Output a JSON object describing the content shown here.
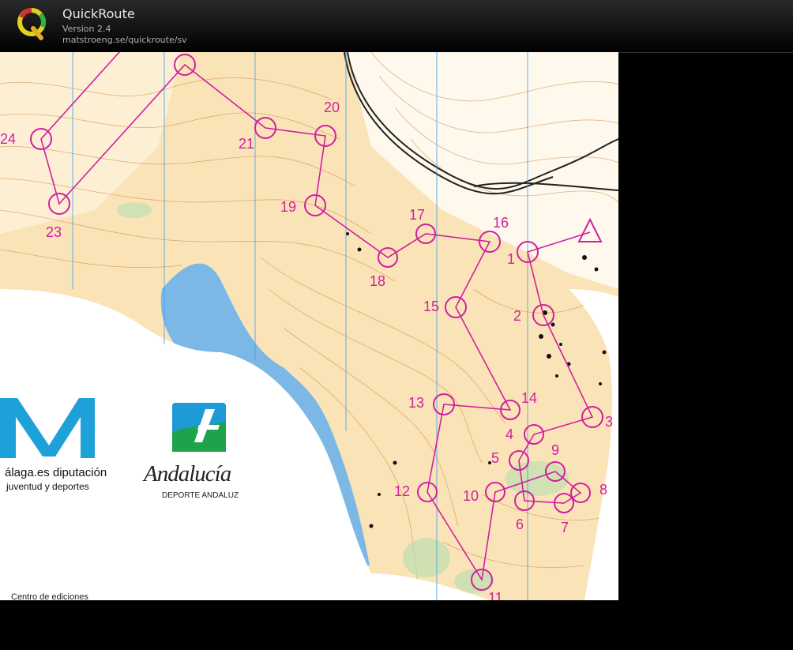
{
  "window": {
    "app_title": "QuickRoute",
    "version": "Version 2.4",
    "url": "matstroeng.se/quickroute/sv",
    "logo_letter": "Q"
  },
  "map": {
    "sponsor_diputacion": "álaga.es diputación",
    "sponsor_diputacion_sub": "juventud y deportes",
    "sponsor_andalucia": "Andalucía",
    "sponsor_andalucia_sub": "DEPORTE ANDALUZ",
    "centro_text": "Centro de ediciones",
    "course_color": "#d020a0",
    "water_color": "#7cb8e6",
    "land_color": "#fbe3b8",
    "controls": [
      "1",
      "2",
      "3",
      "4",
      "5",
      "6",
      "7",
      "8",
      "9",
      "10",
      "11",
      "12",
      "13",
      "14",
      "15",
      "16",
      "17",
      "18",
      "19",
      "20",
      "21",
      "23",
      "24"
    ]
  }
}
